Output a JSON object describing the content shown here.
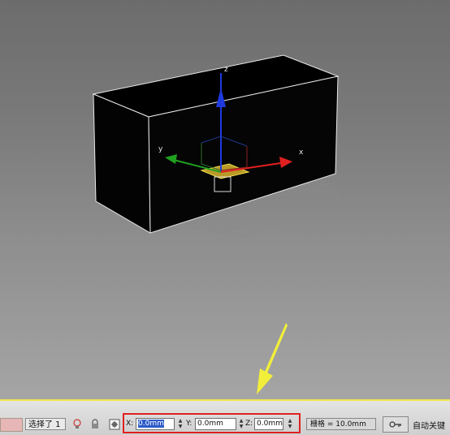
{
  "viewport": {
    "gizmo_axes": {
      "x": "x",
      "y": "y",
      "z": "z"
    }
  },
  "statusbar": {
    "selection_label": "选择了 1",
    "coords": {
      "x_label": "X:",
      "x_value": "0.0mm",
      "y_label": "Y:",
      "y_value": "0.0mm",
      "z_label": "Z:",
      "z_value": "0.0mm"
    },
    "grid_label": "栅格 = 10.0mm",
    "auto_key_label": "自动关键"
  },
  "colors": {
    "highlight_box": "#e02020",
    "arrow_annotation": "#f2ef3a",
    "statusbar_line": "#f0e84a",
    "x_axis": "#e02020",
    "y_axis": "#20a020",
    "z_axis": "#1e3adf"
  },
  "icons": [
    "lightbulb-icon",
    "lock-icon",
    "absolute-transform-icon",
    "key-icon"
  ]
}
